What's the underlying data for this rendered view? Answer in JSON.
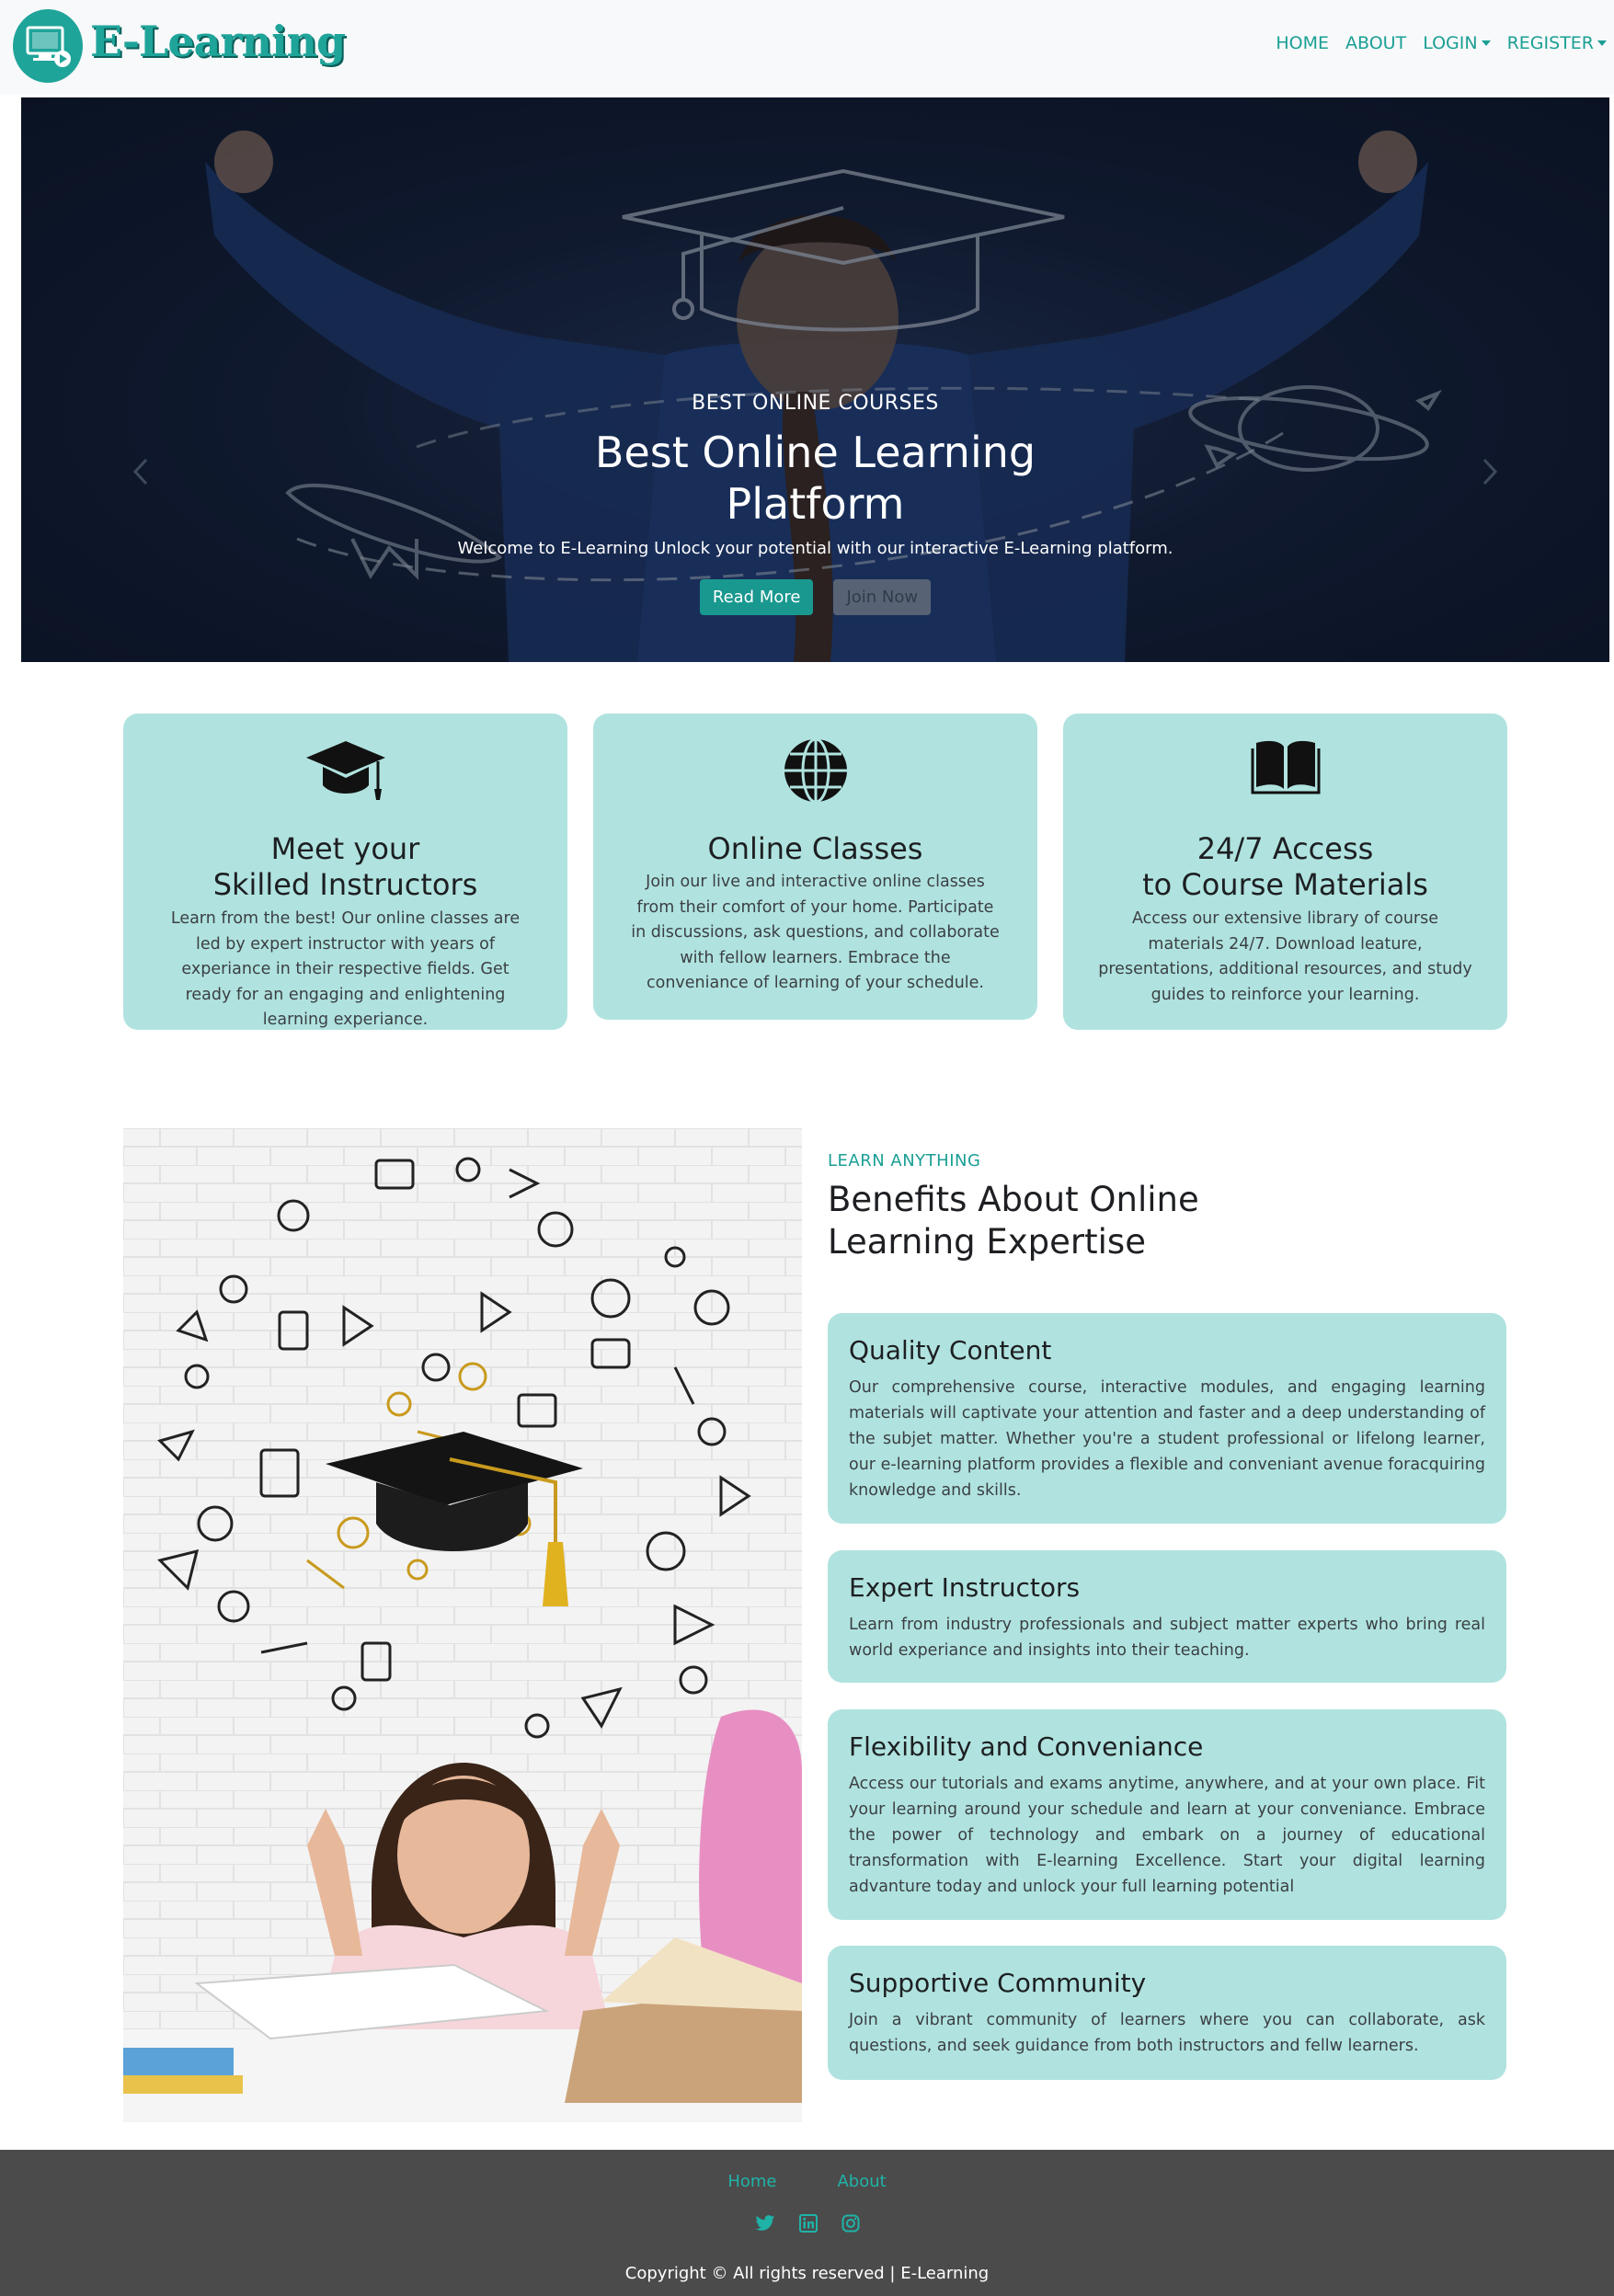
{
  "brand": {
    "name": "E-Learning",
    "logo_icon": "computer-play-icon",
    "color": "#1fa49a"
  },
  "nav": {
    "home": "HOME",
    "about": "ABOUT",
    "login": "LOGIN",
    "register": "REGISTER"
  },
  "hero": {
    "eyebrow": "BEST ONLINE COURSES",
    "title_line1": "Best Online Learning",
    "title_line2": "Platform",
    "subtitle": "Welcome to E-Learning Unlock your potential with our interactive E-Learning platform.",
    "read_more": "Read More",
    "join_now": "Join Now"
  },
  "features": [
    {
      "icon": "graduation-cap-icon",
      "title_line1": "Meet your",
      "title_line2": "Skilled Instructors",
      "text": "Learn from the best! Our online classes are led by expert instructor with years of experiance in their respective fields. Get ready for an engaging and enlightening learning experiance."
    },
    {
      "icon": "globe-icon",
      "title_line1": "Online Classes",
      "title_line2": "",
      "text": "Join our live and interactive online classes from their comfort of your home. Participate in discussions, ask questions, and collaborate with fellow learners. Embrace the conveniance of learning of your schedule."
    },
    {
      "icon": "open-book-icon",
      "title_line1": "24/7 Access",
      "title_line2": "to Course Materials",
      "text": "Access our extensive library of course materials 24/7. Download leature, presentations, additional resources, and study guides to reinforce your learning."
    }
  ],
  "benefits": {
    "eyebrow": "LEARN ANYTHING",
    "heading_line1": "Benefits About Online",
    "heading_line2": "Learning Expertise",
    "items": [
      {
        "title": "Quality Content",
        "text": "Our comprehensive course, interactive modules, and engaging learning materials will captivate your attention and faster and a deep understanding of the subjet matter. Whether you're a student professional or lifelong learner, our e-learning platform provides a flexible and conveniant avenue foracquiring knowledge and skills."
      },
      {
        "title": "Expert Instructors",
        "text": "Learn from industry professionals and subject matter experts who bring real world experiance and insights into their teaching."
      },
      {
        "title": "Flexibility and Conveniance",
        "text": "Access our tutorials and exams anytime, anywhere, and at your own place. Fit your learning around your schedule and learn at your conveniance. Embrace the power of technology and embark on a journey of educational transformation with E-learning Excellence. Start your digital learning advanture today and unlock your full learning potential"
      },
      {
        "title": "Supportive Community",
        "text": "Join a vibrant community of learners where you can collaborate, ask questions, and seek guidance from both instructors and fellw learners."
      }
    ]
  },
  "footer": {
    "home": "Home",
    "about": "About",
    "social": [
      "twitter-icon",
      "linkedin-icon",
      "instagram-icon"
    ],
    "copyright": "Copyright © All rights reserved | E-Learning"
  },
  "colors": {
    "accent": "#1a9f95",
    "card_bg": "#b0e3df",
    "footer_bg": "#4b4b4b",
    "navbar_bg": "#f8f9fa"
  }
}
